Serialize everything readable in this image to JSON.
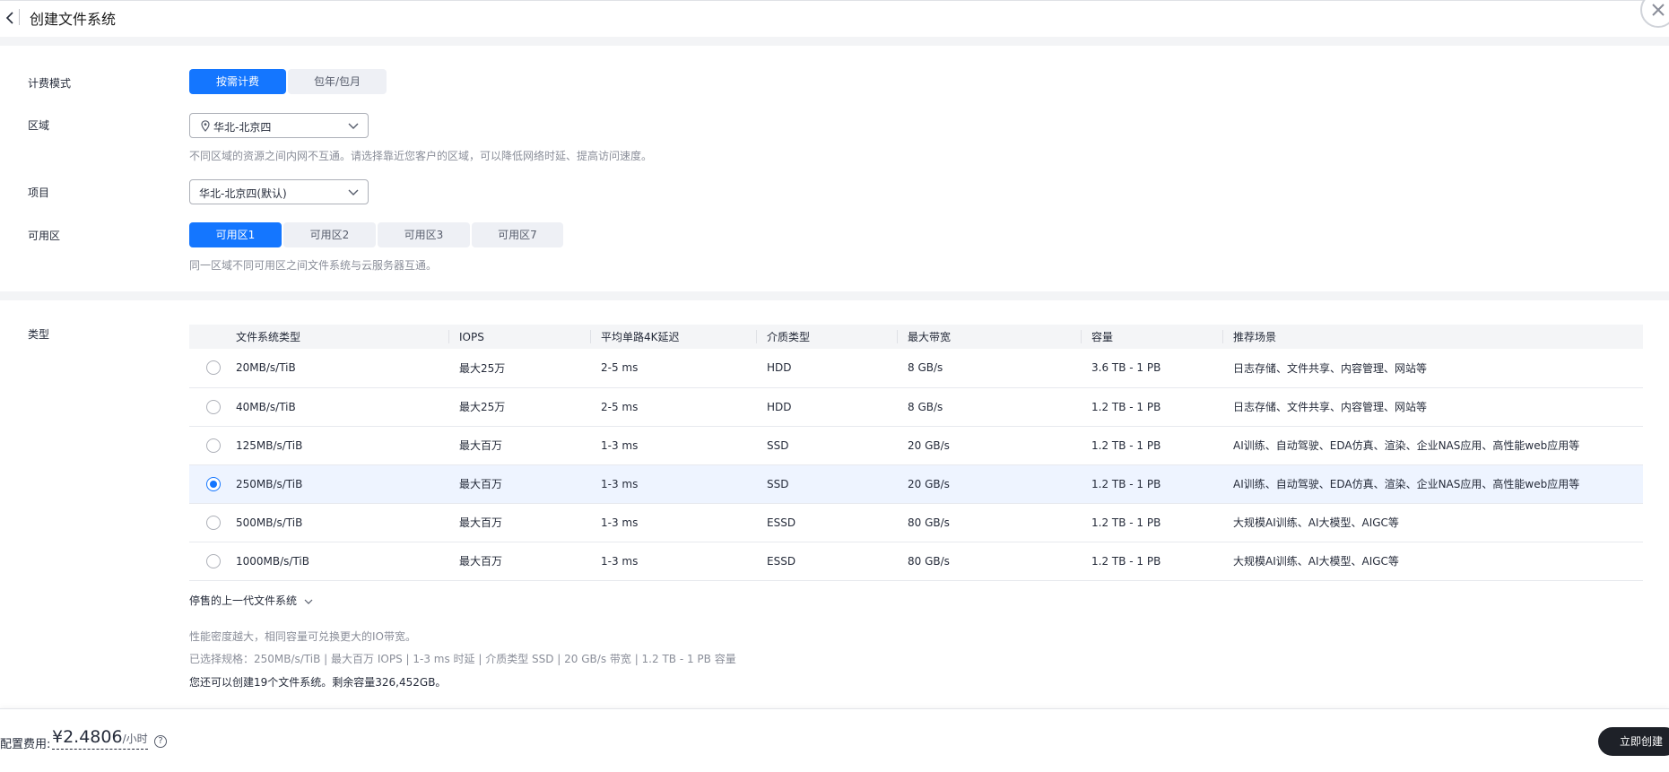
{
  "header": {
    "title": "创建文件系统"
  },
  "billing": {
    "label": "计费模式",
    "options": [
      "按需计费",
      "包年/包月"
    ],
    "selected": "按需计费"
  },
  "region": {
    "label": "区域",
    "value": "华北-北京四",
    "hint": "不同区域的资源之间内网不互通。请选择靠近您客户的区域，可以降低网络时延、提高访问速度。"
  },
  "project": {
    "label": "项目",
    "value": "华北-北京四(默认)"
  },
  "az": {
    "label": "可用区",
    "options": [
      "可用区1",
      "可用区2",
      "可用区3",
      "可用区7"
    ],
    "selected": "可用区1",
    "hint": "同一区域不同可用区之间文件系统与云服务器互通。"
  },
  "type": {
    "label": "类型",
    "columns": [
      "文件系统类型",
      "IOPS",
      "平均单路4K延迟",
      "介质类型",
      "最大带宽",
      "容量",
      "推荐场景"
    ],
    "rows": [
      {
        "name": "20MB/s/TiB",
        "iops": "最大25万",
        "latency": "2-5 ms",
        "media": "HDD",
        "bandwidth": "8 GB/s",
        "capacity": "3.6 TB - 1 PB",
        "scenario": "日志存储、文件共享、内容管理、网站等",
        "selected": false
      },
      {
        "name": "40MB/s/TiB",
        "iops": "最大25万",
        "latency": "2-5 ms",
        "media": "HDD",
        "bandwidth": "8 GB/s",
        "capacity": "1.2 TB - 1 PB",
        "scenario": "日志存储、文件共享、内容管理、网站等",
        "selected": false
      },
      {
        "name": "125MB/s/TiB",
        "iops": "最大百万",
        "latency": "1-3 ms",
        "media": "SSD",
        "bandwidth": "20 GB/s",
        "capacity": "1.2 TB - 1 PB",
        "scenario": "AI训练、自动驾驶、EDA仿真、渲染、企业NAS应用、高性能web应用等",
        "selected": false
      },
      {
        "name": "250MB/s/TiB",
        "iops": "最大百万",
        "latency": "1-3 ms",
        "media": "SSD",
        "bandwidth": "20 GB/s",
        "capacity": "1.2 TB - 1 PB",
        "scenario": "AI训练、自动驾驶、EDA仿真、渲染、企业NAS应用、高性能web应用等",
        "selected": true
      },
      {
        "name": "500MB/s/TiB",
        "iops": "最大百万",
        "latency": "1-3 ms",
        "media": "ESSD",
        "bandwidth": "80 GB/s",
        "capacity": "1.2 TB - 1 PB",
        "scenario": "大规模AI训练、AI大模型、AIGC等",
        "selected": false
      },
      {
        "name": "1000MB/s/TiB",
        "iops": "最大百万",
        "latency": "1-3 ms",
        "media": "ESSD",
        "bandwidth": "80 GB/s",
        "capacity": "1.2 TB - 1 PB",
        "scenario": "大规模AI训练、AI大模型、AIGC等",
        "selected": false
      }
    ],
    "discontinued_label": "停售的上一代文件系统",
    "note_density": "性能密度越大，相同容量可兑换更大的IO带宽。",
    "note_selected": "已选择规格：250MB/s/TiB | 最大百万 IOPS | 1-3 ms 时延 | 介质类型 SSD | 20 GB/s 带宽 | 1.2 TB - 1 PB 容量",
    "note_quota": "您还可以创建19个文件系统。剩余容量326,452GB。"
  },
  "footer": {
    "fee_label": "配置费用:",
    "fee_value": "¥2.4806",
    "fee_unit": "/小时",
    "help": "?",
    "create_label": "立即创建"
  },
  "colors": {
    "accent": "#1476ff",
    "band": "#f3f4f6",
    "selected_row": "#eef4ff",
    "create_button": "#1e2128"
  }
}
